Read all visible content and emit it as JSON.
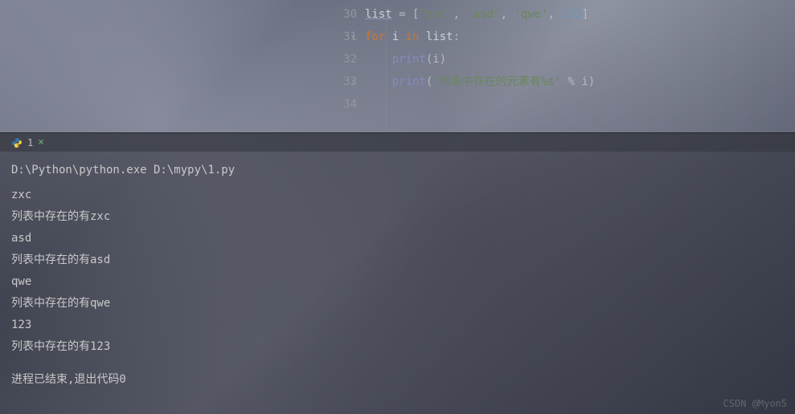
{
  "editor": {
    "lines": [
      {
        "num": "30",
        "fold": "",
        "tokens": [
          {
            "cls": "var underline",
            "t": "list"
          },
          {
            "cls": "punc",
            "t": " = ["
          },
          {
            "cls": "str",
            "t": "'zxc'"
          },
          {
            "cls": "punc",
            "t": ", "
          },
          {
            "cls": "str",
            "t": "'asd'"
          },
          {
            "cls": "punc",
            "t": ", "
          },
          {
            "cls": "str",
            "t": "'qwe'"
          },
          {
            "cls": "punc",
            "t": ", "
          },
          {
            "cls": "num",
            "t": "123"
          },
          {
            "cls": "punc",
            "t": "]"
          }
        ]
      },
      {
        "num": "31",
        "fold": "▾",
        "tokens": [
          {
            "cls": "kw",
            "t": "for "
          },
          {
            "cls": "plain",
            "t": "i "
          },
          {
            "cls": "kw",
            "t": "in "
          },
          {
            "cls": "plain",
            "t": "list"
          },
          {
            "cls": "punc",
            "t": ":"
          }
        ]
      },
      {
        "num": "32",
        "fold": "",
        "tokens": [
          {
            "cls": "plain",
            "t": "    "
          },
          {
            "cls": "fn",
            "t": "print"
          },
          {
            "cls": "punc",
            "t": "(i)"
          }
        ]
      },
      {
        "num": "33",
        "fold": "▵",
        "tokens": [
          {
            "cls": "plain",
            "t": "    "
          },
          {
            "cls": "fn",
            "t": "print"
          },
          {
            "cls": "punc",
            "t": "("
          },
          {
            "cls": "str",
            "t": "'列表中存在的元素有%s'"
          },
          {
            "cls": "punc",
            "t": " % i)"
          }
        ]
      },
      {
        "num": "34",
        "fold": "",
        "tokens": []
      }
    ]
  },
  "tab": {
    "label": "1",
    "close": "×"
  },
  "console": {
    "command": "D:\\Python\\python.exe D:\\mypy\\1.py",
    "output": [
      "zxc",
      "列表中存在的有zxc",
      "asd",
      "列表中存在的有asd",
      "qwe",
      "列表中存在的有qwe",
      "123",
      "列表中存在的有123"
    ],
    "footer": "进程已结束,退出代码0"
  },
  "watermark": "CSDN @Myon5"
}
